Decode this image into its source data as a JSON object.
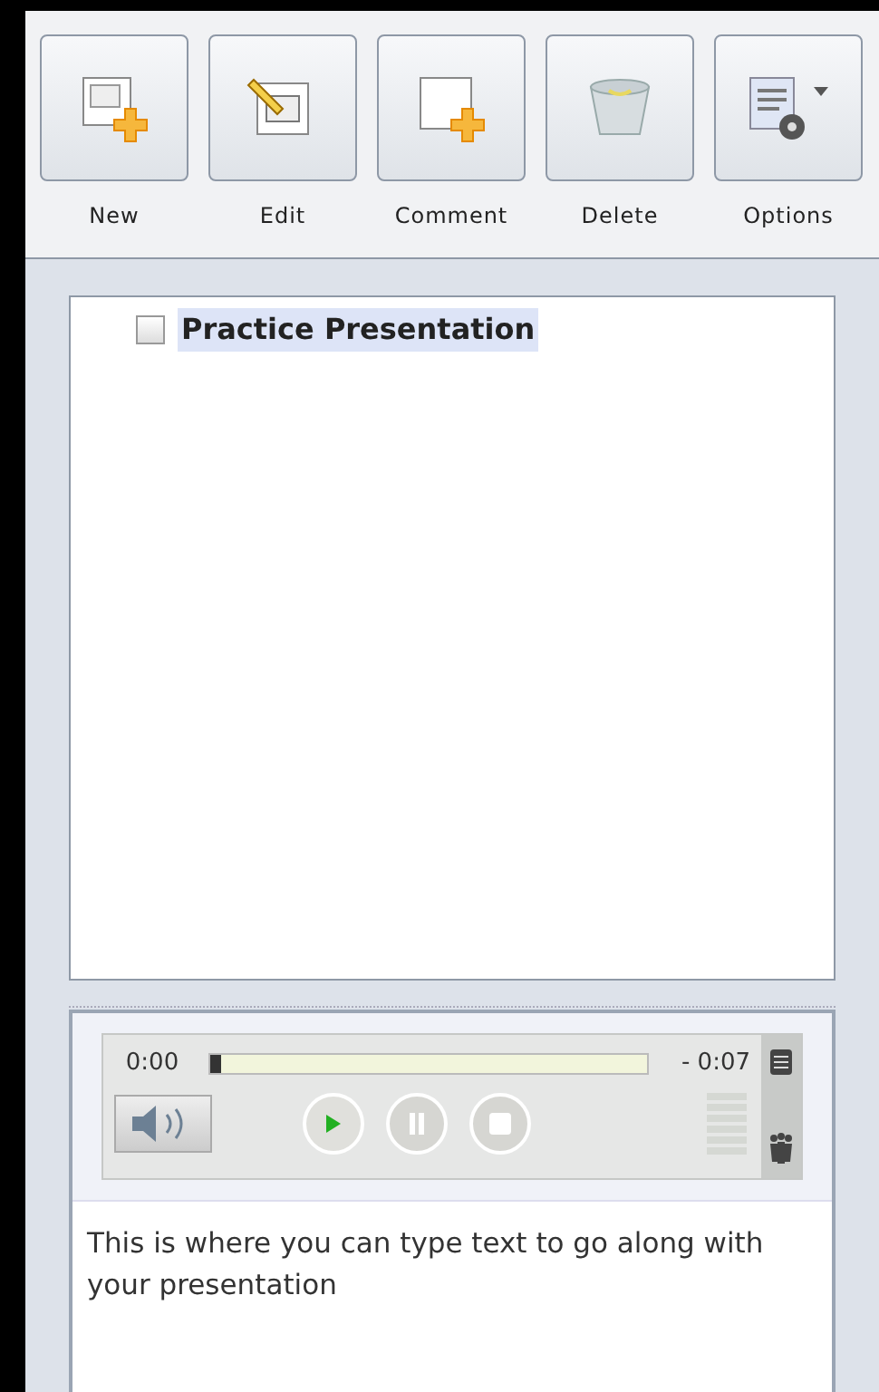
{
  "toolbar": [
    {
      "kind": "new",
      "label": "New"
    },
    {
      "kind": "edit",
      "label": "Edit"
    },
    {
      "kind": "comment",
      "label": "Comment"
    },
    {
      "kind": "delete",
      "label": "Delete"
    },
    {
      "kind": "options",
      "label": "Options"
    }
  ],
  "tree": {
    "items": [
      {
        "label": "Practice Presentation",
        "checked": false,
        "selected": true
      }
    ]
  },
  "player": {
    "elapsed": "0:00",
    "remaining": "- 0:07",
    "level": 0
  },
  "notes": {
    "value": "This is where you can type text to go along with your presentation"
  }
}
